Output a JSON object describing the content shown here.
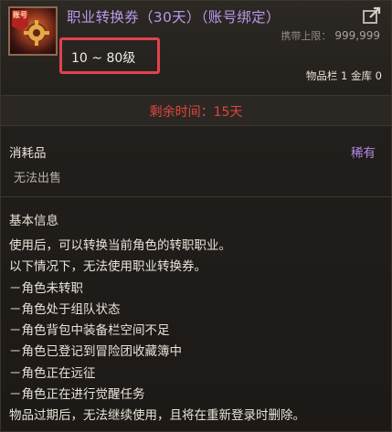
{
  "item": {
    "name": "职业转换券（30天）（账号绑定）",
    "icon": "job-change-ticket-icon",
    "icon_tag": "账号",
    "level_range": "10 ~ 80级",
    "carry_limit_label": "携带上限：",
    "carry_limit_value": "999,999",
    "inventory": "物品栏 1 金库 0"
  },
  "remaining_time": "剩余时间：15天",
  "category": {
    "label": "消耗品",
    "rarity": "稀有",
    "sell_note": "无法出售"
  },
  "basic_info": {
    "title": "基本信息",
    "lines": [
      "使用后，可以转换当前角色的转职职业。",
      "以下情况下，无法使用职业转换券。",
      "－角色未转职",
      "－角色处于组队状态",
      "－角色背包中装备栏空间不足",
      "－角色已登记到冒险团收藏簿中",
      "－角色正在远征",
      "－角色正在进行觉醒任务",
      "物品过期后，无法继续使用，且将在重新登录时删除。"
    ]
  },
  "colors": {
    "item_name": "#b998ea",
    "highlight_box": "#e2414f",
    "remaining_time": "#e0443e",
    "rarity": "#b48ae6"
  }
}
